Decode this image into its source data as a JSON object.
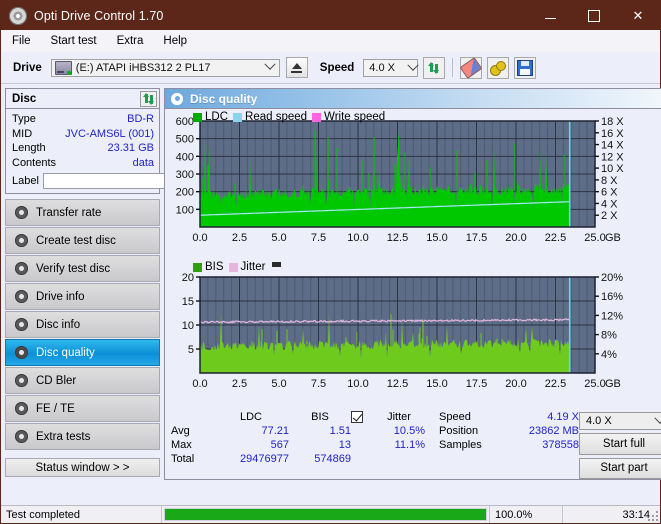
{
  "window": {
    "title": "Opti Drive Control 1.70",
    "icon": "disc-icon",
    "minimize": "–",
    "maximize": "□",
    "close": "✕"
  },
  "menu": {
    "items": [
      {
        "label": "File"
      },
      {
        "label": "Start test"
      },
      {
        "label": "Extra"
      },
      {
        "label": "Help"
      }
    ]
  },
  "toolbar": {
    "drive_label": "Drive",
    "drive_value": "(E:)  ATAPI iHBS312  2 PL17",
    "eject_icon": "eject-icon",
    "speed_label": "Speed",
    "speed_value": "4.0 X",
    "refresh_icon": "refresh-icon",
    "erase_icon": "eraser-icon",
    "gears_icon": "gears-icon",
    "save_icon": "save-icon"
  },
  "disc_panel": {
    "title": "Disc",
    "refresh_icon": "refresh-arrows-icon",
    "rows": [
      {
        "key": "Type",
        "value": "BD-R"
      },
      {
        "key": "MID",
        "value": "JVC-AMS6L (001)"
      },
      {
        "key": "Length",
        "value": "23.31 GB"
      },
      {
        "key": "Contents",
        "value": "data"
      }
    ],
    "label_key": "Label",
    "label_value": "",
    "label_placeholder": "",
    "disc_button_icon": "disc-icon"
  },
  "sidebar": {
    "items": [
      {
        "label": "Transfer rate",
        "icon": "disc-icon",
        "active": false
      },
      {
        "label": "Create test disc",
        "icon": "disc-icon",
        "active": false
      },
      {
        "label": "Verify test disc",
        "icon": "disc-icon",
        "active": false
      },
      {
        "label": "Drive info",
        "icon": "disc-icon",
        "active": false
      },
      {
        "label": "Disc info",
        "icon": "disc-icon",
        "active": false
      },
      {
        "label": "Disc quality",
        "icon": "disc-icon",
        "active": true
      },
      {
        "label": "CD Bler",
        "icon": "disc-icon",
        "active": false
      },
      {
        "label": "FE / TE",
        "icon": "disc-icon",
        "active": false
      },
      {
        "label": "Extra tests",
        "icon": "disc-icon",
        "active": false
      }
    ],
    "status_button": "Status window > >"
  },
  "panel": {
    "title": "Disc quality",
    "icon": "disc-quality-icon"
  },
  "stats": {
    "col_headers": [
      "LDC",
      "BIS"
    ],
    "row_labels": [
      "Avg",
      "Max",
      "Total"
    ],
    "ldc": {
      "avg": "77.21",
      "max": "567",
      "total": "29476977"
    },
    "bis": {
      "avg": "1.51",
      "max": "13",
      "total": "574869"
    },
    "jitter": {
      "label": "Jitter",
      "checked": true,
      "avg": "10.5%",
      "max": "11.1%"
    },
    "speed_key": "Speed",
    "speed_value": "4.19 X",
    "position_key": "Position",
    "position_value": "23862 MB",
    "samples_key": "Samples",
    "samples_value": "378558",
    "speed_select": "4.0 X",
    "start_full": "Start full",
    "start_part": "Start part"
  },
  "statusbar": {
    "message": "Test completed",
    "percent_label": "100.0%",
    "percent": 100,
    "elapsed": "33:14"
  },
  "colors": {
    "titlebar": "#5c2718",
    "ldc_green": "#00c800",
    "read_speed": "#8ad4f0",
    "write_speed": "#ff63e0",
    "bis_green": "#6ecb1e",
    "jitter_pink": "#e3b7dd",
    "plot_bg": "#5e6d87",
    "accent_blue": "#2222cc",
    "progress_green": "#18a818",
    "active_nav": "#0d8fd6"
  },
  "chart_data": [
    {
      "type": "area",
      "name": "ldc-chart",
      "title": "",
      "legend": [
        {
          "label": "LDC",
          "color": "#00aa00"
        },
        {
          "label": "Read speed",
          "color": "#8ad4f0"
        },
        {
          "label": "Write speed",
          "color": "#ff63e0"
        }
      ],
      "legend_position": "top-left",
      "grid": true,
      "xlabel": "GB",
      "xlim": [
        0.0,
        25.0
      ],
      "xticks": [
        "0.0",
        "2.5",
        "5.0",
        "7.5",
        "10.0",
        "12.5",
        "15.0",
        "17.5",
        "20.0",
        "22.5",
        "25.0"
      ],
      "ylabel_left": "LDC",
      "ylim_left": [
        0,
        600
      ],
      "yticks_left": [
        "100",
        "200",
        "300",
        "400",
        "500",
        "600"
      ],
      "ylabel_right": "Speed",
      "ylim_right": [
        0,
        18
      ],
      "yticks_right": [
        "2 X",
        "4 X",
        "6 X",
        "8 X",
        "10 X",
        "12 X",
        "14 X",
        "16 X",
        "18 X"
      ],
      "data_extent_gb": 23.4,
      "series": [
        {
          "name": "LDC",
          "type": "area",
          "color": "#00c800",
          "baseline_avg": 77.21,
          "band_top": 230,
          "spike_max": 567
        },
        {
          "name": "Read speed",
          "type": "line",
          "color": "#a8e6fb",
          "start_x": 0.0,
          "start_y": 2.0,
          "end_x": 23.4,
          "end_y": 4.3
        }
      ]
    },
    {
      "type": "area",
      "name": "bis-chart",
      "title": "",
      "legend": [
        {
          "label": "BIS",
          "color": "#2fa00f"
        },
        {
          "label": "Jitter",
          "color": "#e3b7dd"
        }
      ],
      "legend_position": "top-left",
      "grid": true,
      "xlabel": "GB",
      "xlim": [
        0.0,
        25.0
      ],
      "xticks": [
        "0.0",
        "2.5",
        "5.0",
        "7.5",
        "10.0",
        "12.5",
        "15.0",
        "17.5",
        "20.0",
        "22.5",
        "25.0"
      ],
      "ylabel_left": "BIS",
      "ylim_left": [
        0,
        20
      ],
      "yticks_left": [
        "5",
        "10",
        "15",
        "20"
      ],
      "ylabel_right": "Jitter",
      "ylim_right": [
        0,
        20
      ],
      "yticks_right": [
        "4%",
        "8%",
        "12%",
        "16%",
        "20%"
      ],
      "data_extent_gb": 23.4,
      "series": [
        {
          "name": "BIS",
          "type": "area",
          "color": "#6ecb1e",
          "baseline_avg": 1.51,
          "band_top": 6.5,
          "spike_max": 13
        },
        {
          "name": "Jitter",
          "type": "line",
          "color": "#e3b7dd",
          "start_x": 0.0,
          "start_y": 10.6,
          "end_x": 23.4,
          "end_y": 11.1
        }
      ]
    }
  ]
}
